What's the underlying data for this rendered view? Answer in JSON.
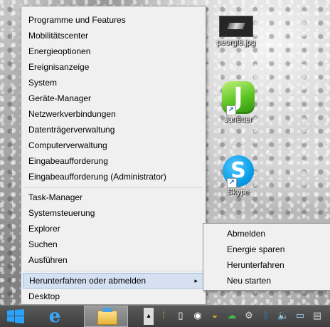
{
  "desktop": {
    "icons": [
      {
        "label": "peorgl8.jpg",
        "icon": "image-file-icon"
      },
      {
        "label": "Janetter",
        "icon": "janetter-app-icon",
        "glyph": "J"
      },
      {
        "label": "Skype",
        "icon": "skype-app-icon",
        "glyph": "S"
      }
    ]
  },
  "menu": {
    "items": [
      {
        "label": "Programme und Features"
      },
      {
        "label": "Mobilitätscenter"
      },
      {
        "label": "Energieoptionen"
      },
      {
        "label": "Ereignisanzeige"
      },
      {
        "label": "System"
      },
      {
        "label": "Geräte-Manager"
      },
      {
        "label": "Netzwerkverbindungen"
      },
      {
        "label": "Datenträgerverwaltung"
      },
      {
        "label": "Computerverwaltung"
      },
      {
        "label": "Eingabeaufforderung"
      },
      {
        "label": "Eingabeaufforderung (Administrator)"
      },
      {
        "label": "Task-Manager"
      },
      {
        "label": "Systemsteuerung"
      },
      {
        "label": "Explorer"
      },
      {
        "label": "Suchen"
      },
      {
        "label": "Ausführen"
      },
      {
        "label": "Herunterfahren oder abmelden",
        "submenu_arrow": "▸",
        "highlighted": true
      },
      {
        "label": "Desktop"
      }
    ]
  },
  "submenu": {
    "items": [
      {
        "label": "Abmelden"
      },
      {
        "label": "Energie sparen"
      },
      {
        "label": "Herunterfahren"
      },
      {
        "label": "Neu starten"
      }
    ]
  },
  "taskbar": {
    "ie_glyph": "e",
    "overflow_glyph": "▴",
    "tray": [
      {
        "icon": "green-app-tray-icon",
        "glyph": "⁞",
        "color": "#7ad23a"
      },
      {
        "icon": "notepad-tray-icon",
        "glyph": "▯",
        "color": "#ffffff"
      },
      {
        "icon": "panda-tray-icon",
        "glyph": "◉",
        "color": "#ffffff"
      },
      {
        "icon": "antivirus-tray-icon",
        "glyph": "◒",
        "color": "#e9a23b"
      },
      {
        "icon": "cloud-tray-icon",
        "glyph": "☁",
        "color": "#3fbf4a"
      },
      {
        "icon": "steam-tray-icon",
        "glyph": "⚙",
        "color": "#d9d9d9"
      },
      {
        "icon": "bluetooth-tray-icon",
        "glyph": "ᛒ",
        "color": "#2d7fe0"
      },
      {
        "icon": "volume-tray-icon",
        "glyph": "🔈",
        "color": "#f0c890"
      },
      {
        "icon": "monitor-tray-icon",
        "glyph": "▭",
        "color": "#a8d8ff"
      },
      {
        "icon": "network-tray-icon",
        "glyph": "▤",
        "color": "#d0d0d0"
      }
    ]
  }
}
